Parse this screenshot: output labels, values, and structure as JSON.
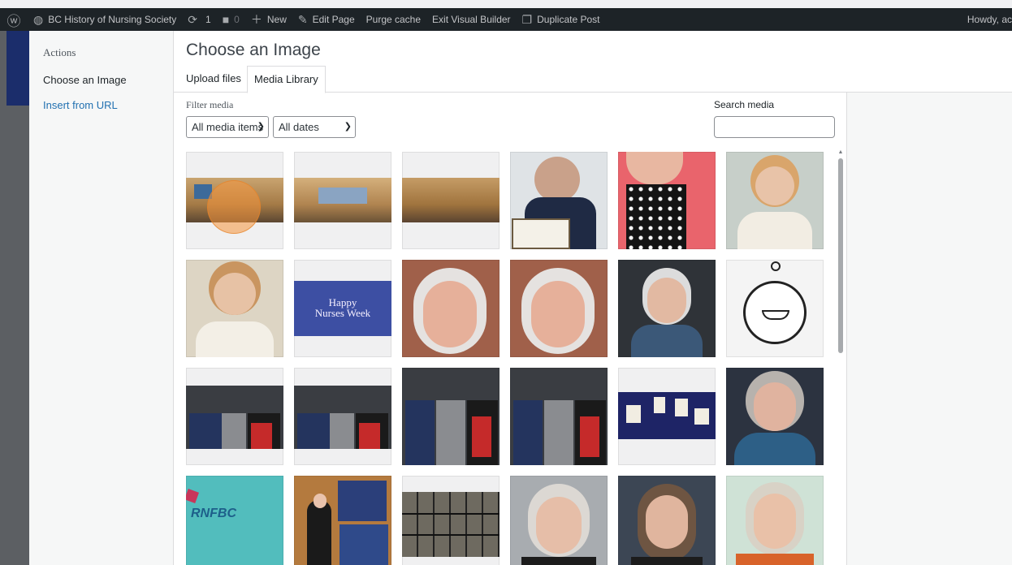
{
  "admin_bar": {
    "site_name": "BC History of Nursing Society",
    "updates_count": "1",
    "comments_count": "0",
    "new_label": "New",
    "edit_page_label": "Edit Page",
    "purge_cache_label": "Purge cache",
    "exit_builder_label": "Exit Visual Builder",
    "duplicate_post_label": "Duplicate Post",
    "howdy_label": "Howdy, ac"
  },
  "modal": {
    "title": "Choose an Image",
    "menu": {
      "heading": "Actions",
      "items": [
        {
          "label": "Choose an Image",
          "active": true
        },
        {
          "label": "Insert from URL",
          "active": false
        }
      ]
    },
    "tabs": [
      {
        "label": "Upload files",
        "active": false
      },
      {
        "label": "Media Library",
        "active": true
      }
    ],
    "filter": {
      "label": "Filter media",
      "type_selected": "All media items",
      "date_selected": "All dates"
    },
    "search": {
      "label": "Search media",
      "value": ""
    },
    "thumbnails": [
      {
        "name": "display-case-1"
      },
      {
        "name": "display-case-2"
      },
      {
        "name": "display-case-3"
      },
      {
        "name": "woman-certificate"
      },
      {
        "name": "woman-polka-dot"
      },
      {
        "name": "nurse-vintage-1"
      },
      {
        "name": "nurse-vintage-2"
      },
      {
        "name": "happy-nurses-week",
        "text": "Happy\nNurses Week"
      },
      {
        "name": "smiling-woman-1"
      },
      {
        "name": "smiling-woman-2"
      },
      {
        "name": "woman-grey-hair"
      },
      {
        "name": "nurse-lamp-clock"
      },
      {
        "name": "group-three-1"
      },
      {
        "name": "group-three-2"
      },
      {
        "name": "group-three-3"
      },
      {
        "name": "group-three-4"
      },
      {
        "name": "artifacts-display"
      },
      {
        "name": "elderly-woman-scarf"
      },
      {
        "name": "rnfbc-logo",
        "text": "RNFBC"
      },
      {
        "name": "exhibit-booth"
      },
      {
        "name": "zoom-meeting"
      },
      {
        "name": "woman-glasses"
      },
      {
        "name": "woman-brown-hair"
      },
      {
        "name": "woman-orange-scarf"
      }
    ]
  }
}
